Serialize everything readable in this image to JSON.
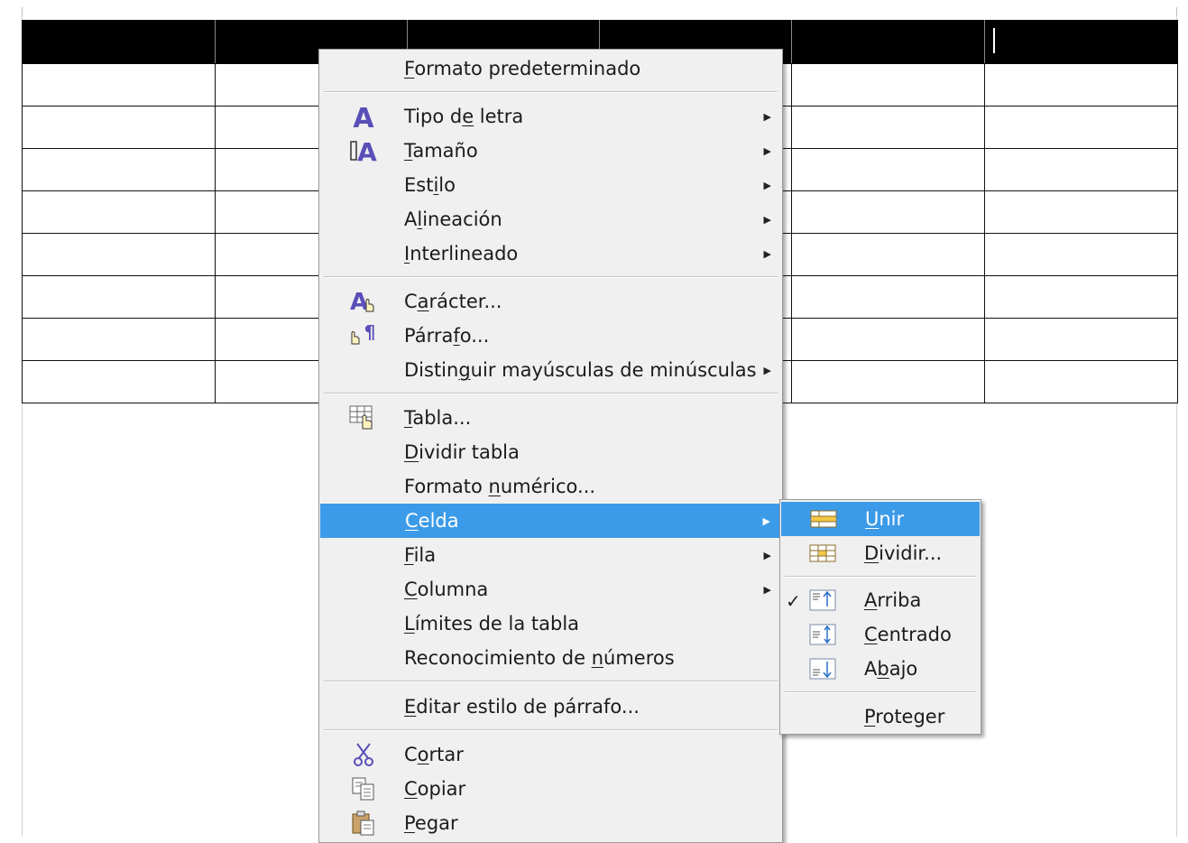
{
  "table": {
    "columns": 6,
    "body_rows": 8
  },
  "main_menu": {
    "items": [
      {
        "pre": "",
        "key": "F",
        "post": "ormato predeterminado",
        "icon": "",
        "submenu": false
      },
      {
        "pre": "Tipo d",
        "key": "e",
        "post": " letra",
        "icon": "font-icon",
        "submenu": true
      },
      {
        "pre": "",
        "key": "T",
        "post": "amaño",
        "icon": "font-size-icon",
        "submenu": true
      },
      {
        "pre": "Est",
        "key": "i",
        "post": "lo",
        "icon": "",
        "submenu": true
      },
      {
        "pre": "A",
        "key": "l",
        "post": "ineación",
        "icon": "",
        "submenu": true
      },
      {
        "pre": "",
        "key": "I",
        "post": "nterlineado",
        "icon": "",
        "submenu": true
      },
      {
        "pre": "C",
        "key": "a",
        "post": "rácter...",
        "icon": "character-icon",
        "submenu": false
      },
      {
        "pre": "Párra",
        "key": "f",
        "post": "o...",
        "icon": "paragraph-icon",
        "submenu": false
      },
      {
        "pre": "Distin",
        "key": "g",
        "post": "uir mayúsculas de minúsculas",
        "icon": "",
        "submenu": true
      },
      {
        "pre": "",
        "key": "T",
        "post": "abla...",
        "icon": "table-properties-icon",
        "submenu": false
      },
      {
        "pre": "",
        "key": "D",
        "post": "ividir tabla",
        "icon": "",
        "submenu": false
      },
      {
        "pre": "Formato ",
        "key": "n",
        "post": "umérico...",
        "icon": "",
        "submenu": false
      },
      {
        "pre": "",
        "key": "C",
        "post": "elda",
        "icon": "",
        "submenu": true
      },
      {
        "pre": "",
        "key": "F",
        "post": "ila",
        "icon": "",
        "submenu": true
      },
      {
        "pre": "",
        "key": "C",
        "post": "olumna",
        "icon": "",
        "submenu": true
      },
      {
        "pre": "",
        "key": "L",
        "post": "ímites de la tabla",
        "icon": "",
        "submenu": false
      },
      {
        "pre": "Reconocimiento de ",
        "key": "n",
        "post": "úmeros",
        "icon": "",
        "submenu": false
      },
      {
        "pre": "",
        "key": "E",
        "post": "ditar estilo de párrafo...",
        "icon": "",
        "submenu": false
      },
      {
        "pre": "C",
        "key": "o",
        "post": "rtar",
        "icon": "cut-icon",
        "submenu": false
      },
      {
        "pre": "",
        "key": "C",
        "post": "opiar",
        "icon": "copy-icon",
        "submenu": false
      },
      {
        "pre": "",
        "key": "P",
        "post": "egar",
        "icon": "paste-icon",
        "submenu": false
      }
    ]
  },
  "sub_menu": {
    "items": [
      {
        "pre": "",
        "key": "U",
        "post": "nir",
        "icon": "merge-cells-icon",
        "checked": false
      },
      {
        "pre": "",
        "key": "D",
        "post": "ividir...",
        "icon": "split-cells-icon",
        "checked": false
      },
      {
        "pre": "",
        "key": "A",
        "post": "rriba",
        "icon": "align-top-icon",
        "checked": true
      },
      {
        "pre": "",
        "key": "C",
        "post": "entrado",
        "icon": "align-center-icon",
        "checked": false
      },
      {
        "pre": "A",
        "key": "b",
        "post": "ajo",
        "icon": "align-bottom-icon",
        "checked": false
      },
      {
        "pre": "",
        "key": "P",
        "post": "roteger",
        "icon": "",
        "checked": false
      }
    ]
  },
  "colors": {
    "highlight": "#3c9be8",
    "menu_bg": "#f0f0f0",
    "icon_purple": "#5a4fb8"
  }
}
